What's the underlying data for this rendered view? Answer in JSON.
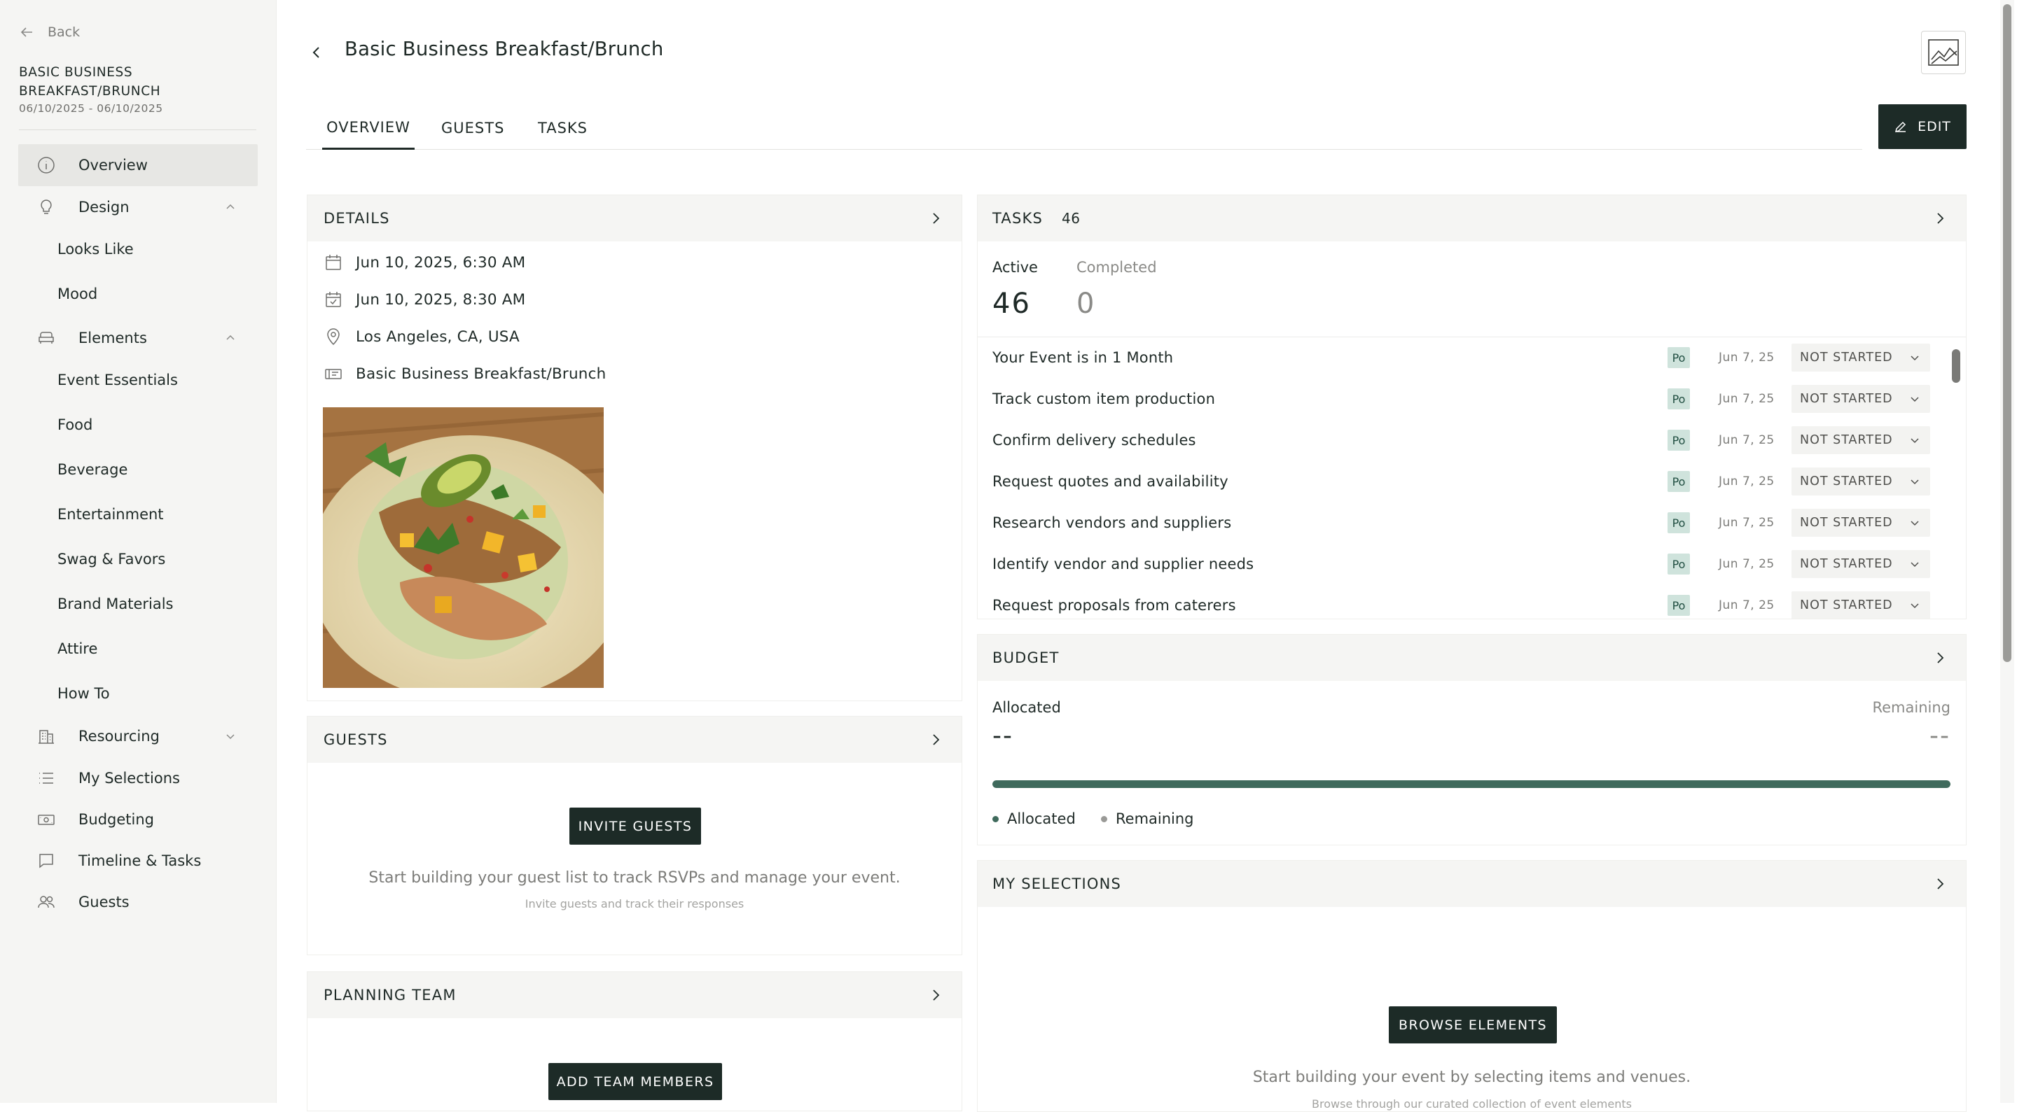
{
  "sidebar": {
    "back_label": "Back",
    "event_title": "BASIC BUSINESS BREAKFAST/BRUNCH",
    "event_dates": "06/10/2025 - 06/10/2025",
    "nav": {
      "overview": "Overview",
      "design": "Design",
      "design_children": [
        "Looks Like",
        "Mood"
      ],
      "elements": "Elements",
      "elements_children": [
        "Event Essentials",
        "Food",
        "Beverage",
        "Entertainment",
        "Swag & Favors",
        "Brand Materials",
        "Attire",
        "How To"
      ],
      "resourcing": "Resourcing",
      "my_selections": "My Selections",
      "budgeting": "Budgeting",
      "timeline_tasks": "Timeline & Tasks",
      "guests": "Guests"
    }
  },
  "header": {
    "title": "Basic Business Breakfast/Brunch",
    "tabs": [
      "OVERVIEW",
      "GUESTS",
      "TASKS"
    ],
    "active_tab": "OVERVIEW",
    "edit_label": "EDIT"
  },
  "details": {
    "title": "DETAILS",
    "start": "Jun 10, 2025, 6:30 AM",
    "end": "Jun 10, 2025, 8:30 AM",
    "location": "Los Angeles, CA, USA",
    "event_name": "Basic Business Breakfast/Brunch"
  },
  "guests": {
    "title": "GUESTS",
    "button": "INVITE GUESTS",
    "empty_main": "Start building your guest list to track RSVPs and manage your event.",
    "empty_sub": "Invite guests and track their responses"
  },
  "planning_team": {
    "title": "PLANNING TEAM",
    "button": "ADD TEAM MEMBERS"
  },
  "tasks": {
    "title": "TASKS",
    "count": "46",
    "active_label": "Active",
    "completed_label": "Completed",
    "active_value": "46",
    "completed_value": "0",
    "rows": [
      {
        "name": "Your Event is in 1 Month",
        "assignee": "Po",
        "date": "Jun 7, 25",
        "status": "NOT STARTED"
      },
      {
        "name": "Track custom item production",
        "assignee": "Po",
        "date": "Jun 7, 25",
        "status": "NOT STARTED"
      },
      {
        "name": "Confirm delivery schedules",
        "assignee": "Po",
        "date": "Jun 7, 25",
        "status": "NOT STARTED"
      },
      {
        "name": "Request quotes and availability",
        "assignee": "Po",
        "date": "Jun 7, 25",
        "status": "NOT STARTED"
      },
      {
        "name": "Research vendors and suppliers",
        "assignee": "Po",
        "date": "Jun 7, 25",
        "status": "NOT STARTED"
      },
      {
        "name": "Identify vendor and supplier needs",
        "assignee": "Po",
        "date": "Jun 7, 25",
        "status": "NOT STARTED"
      },
      {
        "name": "Request proposals from caterers",
        "assignee": "Po",
        "date": "Jun 7, 25",
        "status": "NOT STARTED"
      }
    ]
  },
  "budget": {
    "title": "BUDGET",
    "allocated_label": "Allocated",
    "remaining_label": "Remaining",
    "allocated_value": "--",
    "remaining_value": "--",
    "allocated_fraction": 1.0,
    "legend_allocated": "Allocated",
    "legend_remaining": "Remaining",
    "colors": {
      "allocated": "#3f6a5c",
      "remaining": "#9a9a97"
    }
  },
  "my_selections": {
    "title": "MY SELECTIONS",
    "button": "BROWSE ELEMENTS",
    "empty_main": "Start building your event by selecting items and venues.",
    "empty_sub": "Browse through our curated collection of event elements"
  },
  "icons": {
    "back": "arrow-left-icon",
    "overview": "info-icon",
    "design": "lightbulb-icon",
    "elements": "sofa-icon",
    "resourcing": "building-icon",
    "my_selections": "list-icon",
    "budgeting": "money-icon",
    "timeline": "chat-icon",
    "guests": "users-icon"
  },
  "colors": {
    "accent_dark": "#1d2b27",
    "sidebar_bg": "#f5f5f3",
    "assignee_bg": "#cfe3dc"
  }
}
